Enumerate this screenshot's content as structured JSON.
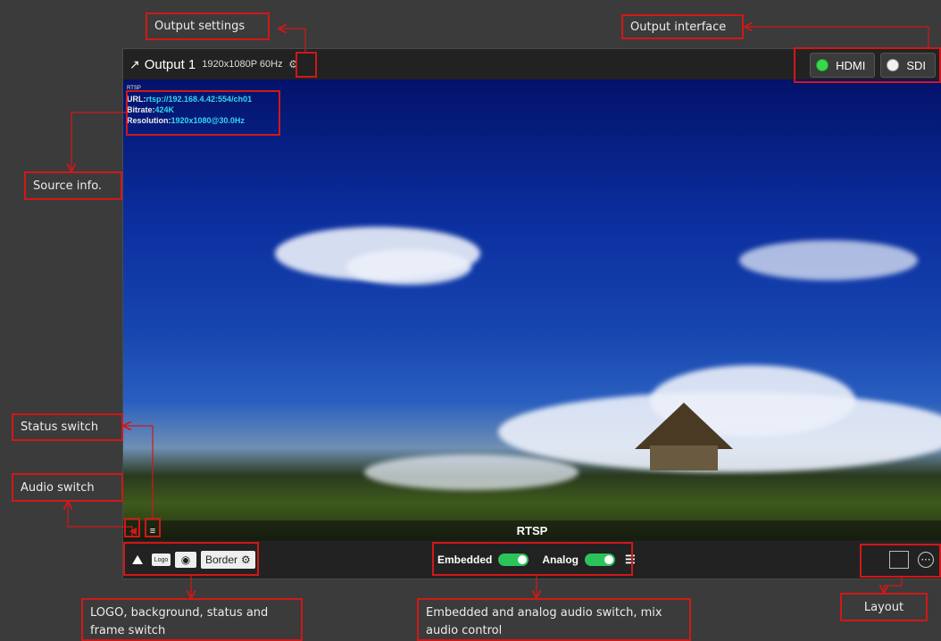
{
  "labels": {
    "output_settings": "Output settings",
    "output_interface": "Output interface",
    "source_info": "Source info.",
    "status_switch": "Status switch",
    "audio_switch": "Audio switch",
    "logo_bg_line1": "LOGO, background, status and",
    "logo_bg_line2": "frame switch",
    "audio_mix_line1": "Embedded and analog audio switch, mix",
    "audio_mix_line2": "audio control",
    "layout": "Layout"
  },
  "output": {
    "title": "Output 1",
    "resolution": "1920x1080P 60Hz",
    "interfaces": [
      {
        "label": "HDMI",
        "active": true
      },
      {
        "label": "SDI",
        "active": false
      }
    ]
  },
  "source": {
    "type": "RTSP",
    "url_label": "URL:",
    "url": "rtsp://192.168.4.42:554/ch01",
    "bitrate_label": "Bitrate:",
    "bitrate": "424K",
    "resolution_label": "Resolution:",
    "resolution": "1920x1080@30.0Hz"
  },
  "toolbar": {
    "logo": "Logo",
    "border": "Border",
    "embedded": "Embedded",
    "analog": "Analog"
  },
  "colors": {
    "accent_red": "#d01818",
    "toggle_on": "#2cc45a",
    "info_cyan": "#35d6f0"
  }
}
